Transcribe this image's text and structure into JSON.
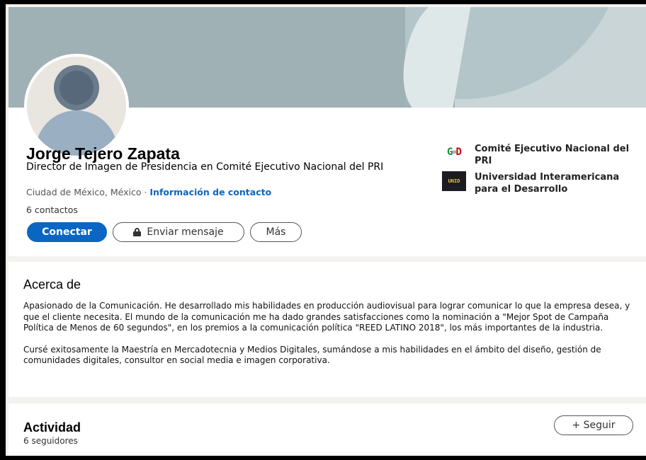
{
  "profile": {
    "name": "Jorge Tejero Zapata",
    "headline": "Director de Imagen de Presidencia en Comité Ejecutivo Nacional del PRI",
    "location": "Ciudad de México, México",
    "location_separator": " · ",
    "contact_link": "Información de contacto",
    "connections": "6 contactos"
  },
  "actions": {
    "connect_label": "Conectar",
    "message_label": "Enviar mensaje",
    "more_label": "Más"
  },
  "organizations": [
    {
      "name": "Comité Ejecutivo Nacional del PRI",
      "logo_icon": "pri-logo-icon"
    },
    {
      "name": "Universidad Interamericana para el Desarrollo",
      "logo_icon": "unid-logo-icon"
    }
  ],
  "about": {
    "title": "Acerca de",
    "paragraphs": [
      "Apasionado de la Comunicación. He desarrollado mis habilidades en producción audiovisual para lograr comunicar lo que la empresa desea, y que el cliente necesita. El mundo de la comunicación me ha dado grandes satisfacciones como la nominación a \"Mejor Spot de Campaña Política de Menos de 60 segundos\", en los premios a la comunicación política \"REED LATINO 2018\", los más importantes de la industria.",
      "Cursé exitosamente la Maestría en Mercadotecnia y Medios Digitales, sumándose a mis habilidades en el ámbito del diseño, gestión de comunidades digitales, consultor en social media e imagen corporativa."
    ]
  },
  "activity": {
    "title": "Actividad",
    "followers": "6 seguidores",
    "follow_label": "+ Seguir"
  },
  "colors": {
    "primary": "#0a66c2",
    "banner": "#a0b4b7"
  }
}
